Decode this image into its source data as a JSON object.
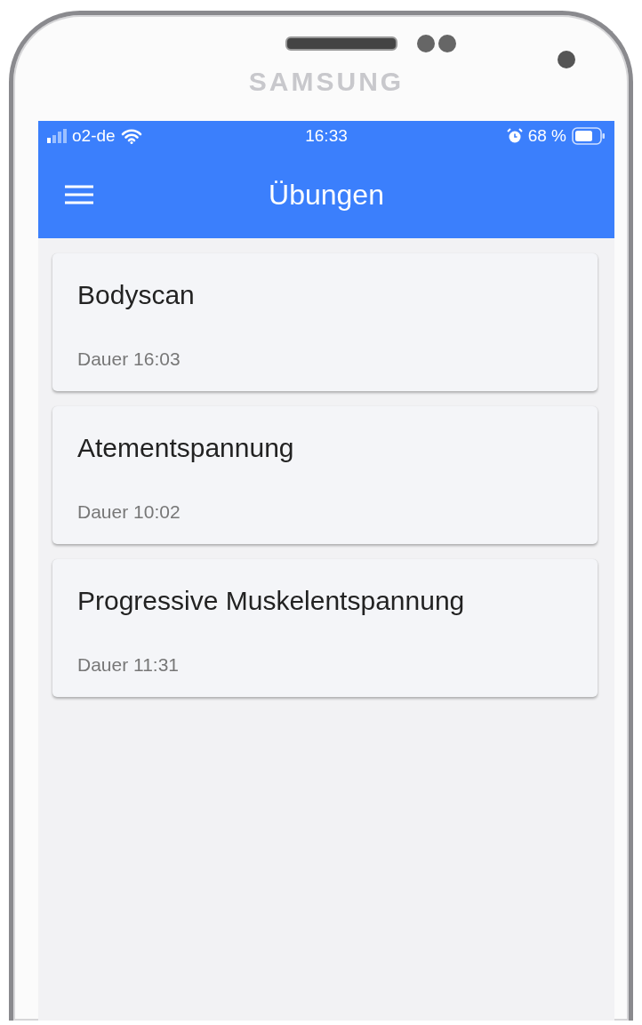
{
  "device": {
    "brand": "SAMSUNG"
  },
  "status_bar": {
    "carrier": "o2-de",
    "time": "16:33",
    "battery": "68 %"
  },
  "app_bar": {
    "title": "Übungen"
  },
  "exercises": [
    {
      "title": "Bodyscan",
      "duration": "Dauer 16:03"
    },
    {
      "title": "Atementspannung",
      "duration": "Dauer 10:02"
    },
    {
      "title": "Progressive Muskelentspannung",
      "duration": "Dauer 11:31"
    }
  ]
}
